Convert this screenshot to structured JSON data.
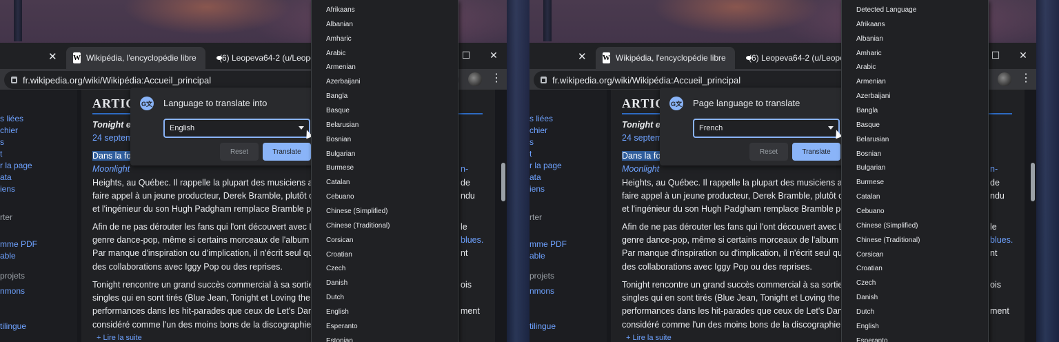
{
  "panels": [
    {
      "tabs": [
        {
          "title": "Wikipédia, l'encyclopédie libre"
        },
        {
          "title": "(6) Leopeva64-2 (u/Leope"
        }
      ],
      "url": "fr.wikipedia.org/wiki/Wikipédia:Accueil_principal",
      "sidebar": [
        "s liées",
        "chier",
        "s",
        "t",
        "r la page",
        "ata",
        "iens",
        "rter",
        "mme PDF",
        "able",
        "projets",
        "nmons",
        "tilingue"
      ],
      "article_heading": "ARTICL",
      "article_lines": [
        "Tonight e",
        "24 septem",
        "Dans la fo",
        "Moonlight",
        "Heights, au Québec. Il rappelle la plupart des musiciens ay",
        "faire appel à un jeune producteur, Derek Bramble, plutôt qu",
        "et l'ingénieur du son Hugh Padgham remplace Bramble po",
        "Afin de ne pas dérouter les fans qui l'ont découvert avec Le",
        "genre dance-pop, même si certains morceaux de l'album so",
        "Par manque d'inspiration ou d'implication, il n'écrit seul que",
        "des collaborations avec Iggy Pop ou des reprises.",
        "Tonight rencontre un grand succès commercial à sa sortie,",
        "singles qui en sont tirés (Blue Jean, Tonight et Loving the A",
        "performances dans les hit-parades que ceux de Let's Danc",
        "considéré comme l'un des moins bons de la discographie d",
        "+ Lire la suite"
      ],
      "article_right": [
        "n-",
        "de",
        "ndu",
        "le",
        "blues.",
        "nt",
        "ois",
        "ment"
      ],
      "bubble": {
        "title": "Language to translate into",
        "selected": "English",
        "reset": "Reset",
        "translate": "Translate"
      },
      "dropdown": [
        "Afrikaans",
        "Albanian",
        "Amharic",
        "Arabic",
        "Armenian",
        "Azerbaijani",
        "Bangla",
        "Basque",
        "Belarusian",
        "Bosnian",
        "Bulgarian",
        "Burmese",
        "Catalan",
        "Cebuano",
        "Chinese (Simplified)",
        "Chinese (Traditional)",
        "Corsican",
        "Croatian",
        "Czech",
        "Danish",
        "Dutch",
        "English",
        "Esperanto",
        "Estonian"
      ]
    },
    {
      "tabs": [
        {
          "title": "Wikipédia, l'encyclopédie libre"
        },
        {
          "title": "(6) Leopeva64-2 (u/Leope"
        }
      ],
      "url": "fr.wikipedia.org/wiki/Wikipédia:Accueil_principal",
      "sidebar": [
        "s liées",
        "chier",
        "s",
        "t",
        "r la page",
        "ata",
        "iens",
        "rter",
        "mme PDF",
        "able",
        "projets",
        "nmons",
        "tilingue"
      ],
      "article_heading": "ARTICL",
      "article_lines": [
        "Tonight e",
        "24 septem",
        "Dans la fo",
        "Moonlight",
        "Heights, au Québec. Il rappelle la plupart des musiciens ay",
        "faire appel à un jeune producteur, Derek Bramble, plutôt qu",
        "et l'ingénieur du son Hugh Padgham remplace Bramble po",
        "Afin de ne pas dérouter les fans qui l'ont découvert avec Le",
        "genre dance-pop, même si certains morceaux de l'album so",
        "Par manque d'inspiration ou d'implication, il n'écrit seul que",
        "des collaborations avec Iggy Pop ou des reprises.",
        "Tonight rencontre un grand succès commercial à sa sortie,",
        "singles qui en sont tirés (Blue Jean, Tonight et Loving the A",
        "performances dans les hit-parades que ceux de Let's Danc",
        "considéré comme l'un des moins bons de la discographie d",
        "+ Lire la suite"
      ],
      "article_right": [
        "n-",
        "de",
        "ndu",
        "le",
        "blues.",
        "nt",
        "ois",
        "ment"
      ],
      "bubble": {
        "title": "Page language to translate",
        "selected": "French",
        "reset": "Reset",
        "translate": "Translate"
      },
      "dropdown": [
        "Detected Language",
        "Afrikaans",
        "Albanian",
        "Amharic",
        "Arabic",
        "Armenian",
        "Azerbaijani",
        "Bangla",
        "Basque",
        "Belarusian",
        "Bosnian",
        "Bulgarian",
        "Burmese",
        "Catalan",
        "Cebuano",
        "Chinese (Simplified)",
        "Chinese (Traditional)",
        "Corsican",
        "Croatian",
        "Czech",
        "Danish",
        "Dutch",
        "English",
        "Esperanto"
      ]
    }
  ],
  "colors": {
    "accent": "#8ab4f8",
    "link": "#6ea2ff",
    "surface": "#202124"
  },
  "icons": {
    "lock": "lock-icon",
    "translate": "google-translate-icon",
    "menu": "kebab-menu-icon"
  }
}
